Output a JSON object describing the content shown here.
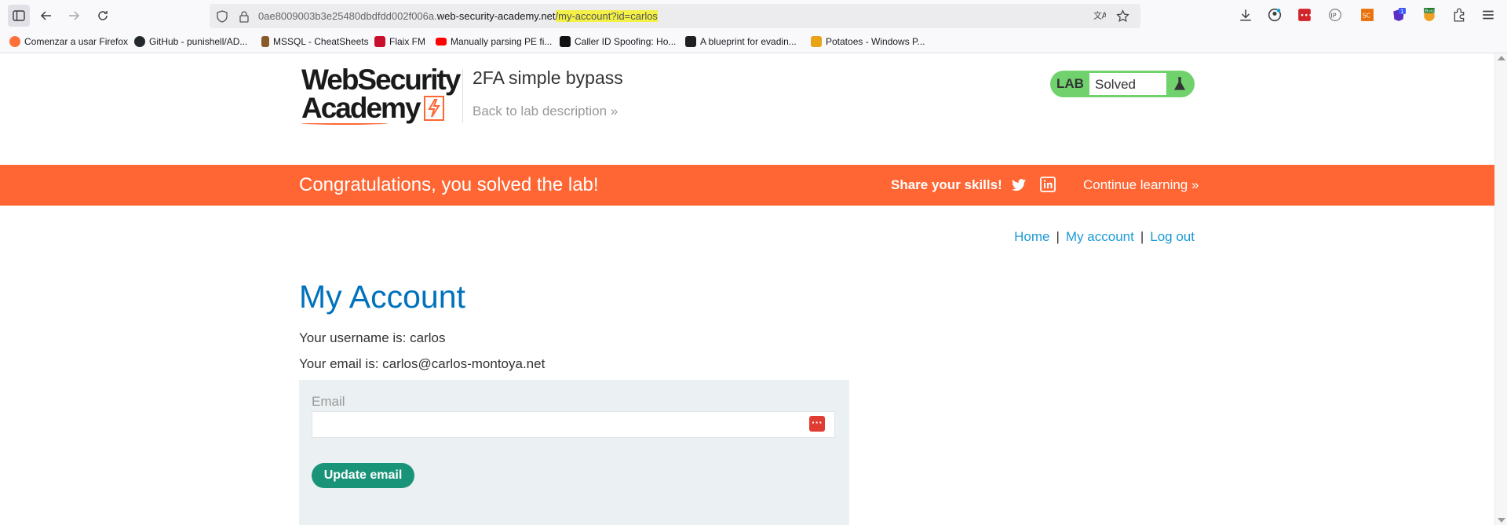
{
  "browser": {
    "url_prefix": "0ae8009003b3e25480dbdfdd002f006a.",
    "url_host": "web-security-academy.net",
    "url_path": "/my-account?id=carlos",
    "bookmarks": [
      {
        "label": "Comenzar a usar Firefox",
        "color": "#ff7139"
      },
      {
        "label": "GitHub - punishell/AD...",
        "color": "#24292e"
      },
      {
        "label": "MSSQL - CheatSheets",
        "color": "#8b5a2b"
      },
      {
        "label": "Flaix FM",
        "color": "#c8102e"
      },
      {
        "label": "Manually parsing PE fi...",
        "color": "#ff0000"
      },
      {
        "label": "Caller ID Spoofing: Ho...",
        "color": "#111111"
      },
      {
        "label": "A blueprint for evadin...",
        "color": "#1f1f1f"
      },
      {
        "label": "Potatoes - Windows P...",
        "color": "#e8a317"
      }
    ],
    "extension_icons": [
      "download-icon",
      "account-icon",
      "password-manager-icon",
      "ip-icon",
      "sc-icon",
      "notification-icon",
      "burp-icon",
      "extensions-icon",
      "menu-icon"
    ]
  },
  "header": {
    "logo_line1": "WebSecurity",
    "logo_line2": "Academy",
    "lab_title": "2FA simple bypass",
    "back_link": "Back to lab description",
    "back_chevron": "»",
    "lab_label": "LAB",
    "lab_status": "Solved"
  },
  "banner": {
    "message": "Congratulations, you solved the lab!",
    "share": "Share your skills!",
    "continue": "Continue learning",
    "continue_chevron": "»"
  },
  "nav": {
    "home": "Home",
    "account": "My account",
    "logout": "Log out",
    "separator": "|"
  },
  "content": {
    "heading": "My Account",
    "username_line": "Your username is: carlos",
    "email_line": "Your email is: carlos@carlos-montoya.net",
    "email_label": "Email",
    "email_value": "",
    "update_button": "Update email"
  },
  "colors": {
    "accent_orange": "#ff6633",
    "link_blue": "#1c9ad6",
    "heading_blue": "#0071bc",
    "button_green": "#1a9478",
    "lab_green": "#70d16d"
  }
}
